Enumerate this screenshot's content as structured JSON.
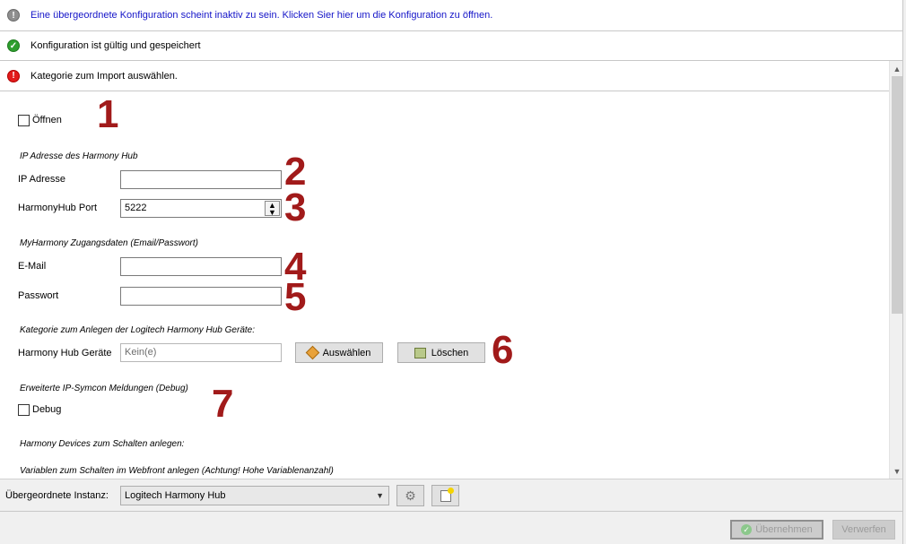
{
  "notices": {
    "parent": "Eine übergeordnete Konfiguration scheint inaktiv zu sein. Klicken Sier hier um die Konfiguration zu öffnen.",
    "valid": "Konfiguration ist gültig und gespeichert",
    "error": "Kategorie zum Import auswählen."
  },
  "form": {
    "open_label": "Öffnen",
    "hub_section": "IP Adresse des Harmony Hub",
    "ip_label": "IP Adresse",
    "ip_value": "",
    "port_label": "HarmonyHub Port",
    "port_value": "5222",
    "account_section": "MyHarmony Zugangsdaten (Email/Passwort)",
    "email_label": "E-Mail",
    "email_value": "",
    "password_label": "Passwort",
    "password_value": "",
    "category_section": "Kategorie zum Anlegen der Logitech Harmony Hub Geräte:",
    "devices_label": "Harmony Hub Geräte",
    "devices_value": "Kein(e)",
    "select_button": "Auswählen",
    "delete_button": "Löschen",
    "debug_section": "Erweiterte IP-Symcon Meldungen (Debug)",
    "debug_label": "Debug",
    "devices_section": "Harmony Devices zum Schalten anlegen:",
    "webfront_section": "Variablen zum Schalten im Webfront anlegen (Achtung! Hohe Variablenanzahl)"
  },
  "annotations": [
    "1",
    "2",
    "3",
    "4",
    "5",
    "6",
    "7"
  ],
  "instance": {
    "label": "Übergeordnete Instanz:",
    "value": "Logitech Harmony Hub"
  },
  "footer": {
    "apply": "Übernehmen",
    "discard": "Verwerfen"
  },
  "icons": {
    "info": "info-icon",
    "ok": "check-icon",
    "error": "error-icon",
    "gear": "gear-icon",
    "new": "new-instance-icon"
  }
}
